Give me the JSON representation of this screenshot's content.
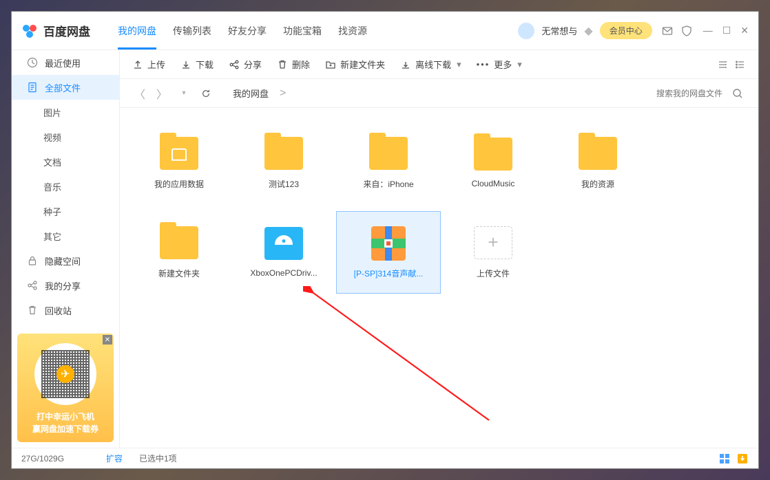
{
  "app": {
    "name": "百度网盘"
  },
  "tabs": [
    "我的网盘",
    "传输列表",
    "好友分享",
    "功能宝箱",
    "找资源"
  ],
  "active_tab": 0,
  "user": {
    "name": "无常想与",
    "vip_button": "会员中心"
  },
  "sidebar": {
    "items": [
      {
        "label": "最近使用",
        "icon": "clock"
      },
      {
        "label": "全部文件",
        "icon": "document",
        "active": true
      },
      {
        "label": "图片",
        "sub": true
      },
      {
        "label": "视频",
        "sub": true
      },
      {
        "label": "文档",
        "sub": true
      },
      {
        "label": "音乐",
        "sub": true
      },
      {
        "label": "种子",
        "sub": true
      },
      {
        "label": "其它",
        "sub": true
      },
      {
        "label": "隐藏空间",
        "icon": "lock"
      },
      {
        "label": "我的分享",
        "icon": "share"
      },
      {
        "label": "回收站",
        "icon": "trash"
      }
    ]
  },
  "promo": {
    "line1": "打中幸运小飞机",
    "line2": "赢网盘加速下载券"
  },
  "toolbar": {
    "upload": "上传",
    "download": "下载",
    "share": "分享",
    "delete": "删除",
    "newfolder": "新建文件夹",
    "offline": "离线下载",
    "more": "更多"
  },
  "breadcrumb": {
    "root": "我的网盘"
  },
  "search": {
    "placeholder": "搜索我的网盘文件"
  },
  "files": [
    {
      "name": "我的应用数据",
      "type": "folder-app"
    },
    {
      "name": "测试123",
      "type": "folder"
    },
    {
      "name": "来自：iPhone",
      "type": "folder"
    },
    {
      "name": "CloudMusic",
      "type": "folder"
    },
    {
      "name": "我的资源",
      "type": "folder"
    },
    {
      "name": "新建文件夹",
      "type": "folder"
    },
    {
      "name": "XboxOnePCDriv...",
      "type": "disk"
    },
    {
      "name": "[P-SP]314音声献...",
      "type": "archive",
      "selected": true
    },
    {
      "name": "上传文件",
      "type": "upload"
    }
  ],
  "status": {
    "quota": "27G/1029G",
    "expand": "扩容",
    "selection": "已选中1项"
  }
}
